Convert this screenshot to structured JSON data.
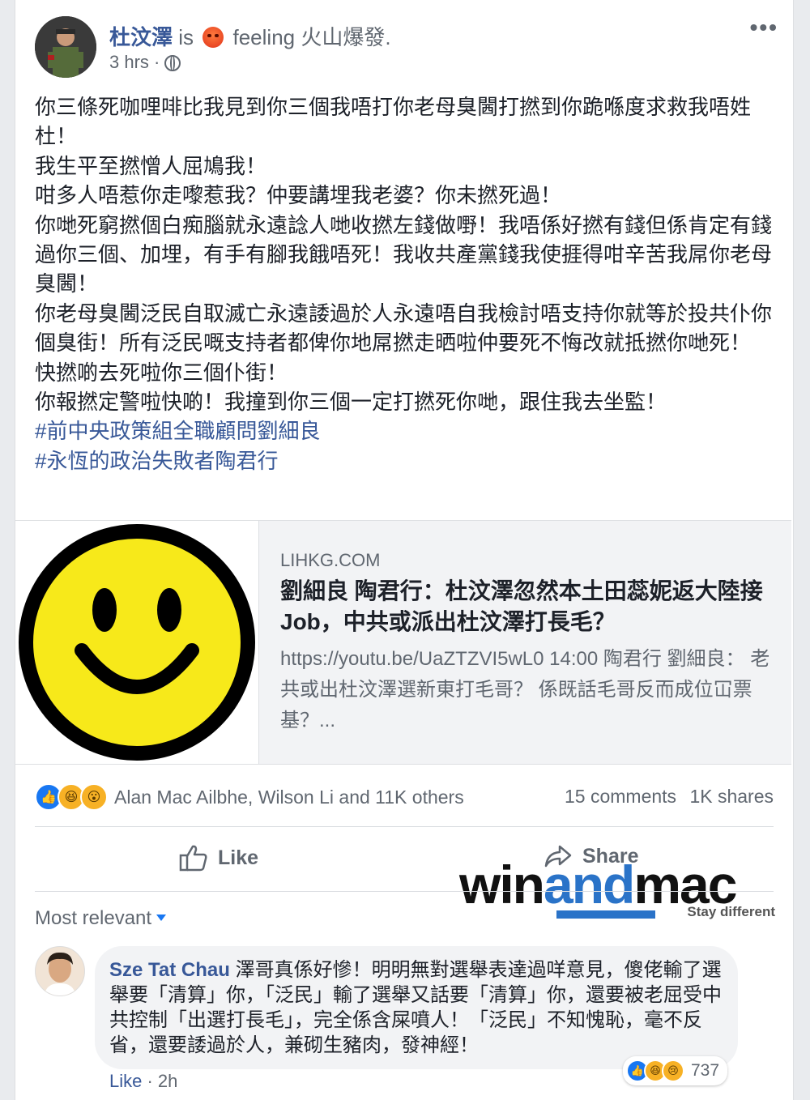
{
  "post": {
    "author": "杜汶澤",
    "feeling_prefix": "is",
    "feeling": "feeling 火山爆發.",
    "time": "3 hrs ·",
    "more_label": "•••",
    "text_lines": [
      "你三條死咖哩啡比我見到你三個我唔打你老母臭閪打撚到你跪喺度求救我唔姓杜！",
      "我生平至撚憎人屈鳩我！",
      "咁多人唔惹你走嚟惹我？仲要講埋我老婆？你未撚死過！",
      "你哋死窮撚個白痴腦就永遠諗人哋收撚左錢做嘢！我唔係好撚有錢但係肯定有錢過你三個、加埋，有手有腳我餓唔死！我收共產黨錢我使捱得咁辛苦我屌你老母臭閪！",
      "你老母臭閪泛民自取滅亡永遠諉過於人永遠唔自我檢討唔支持你就等於投共仆你個臭街！所有泛民嘅支持者都俾你地屌撚走晒啦仲要死不悔改就抵撚你哋死！",
      "快撚啲去死啦你三個仆街！",
      "你報撚定警啦快啲！我撞到你三個一定打撚死你哋，跟住我去坐監！"
    ],
    "hashtags": [
      "#前中央政策組全職顧問劉細良",
      "#永恆的政治失敗者陶君行"
    ]
  },
  "link": {
    "domain": "LIHKG.COM",
    "title": "劉細良 陶君行：杜汶澤忽然本土田蕊妮返大陸接Job，中共或派出杜汶澤打長毛？",
    "description": "https://youtu.be/UaZTZVI5wL0 14:00 陶君行 劉細良： 老共或出杜汶澤選新東打毛哥？ 係既話毛哥反而成位冚票基？..."
  },
  "reactions": {
    "names": "Alan Mac Ailbhe, Wilson Li and 11K others",
    "comments": "15 comments",
    "shares": "1K shares"
  },
  "actions": {
    "like": "Like",
    "share": "Share"
  },
  "watermark": {
    "win": "win",
    "and": "and",
    "mac": "mac",
    "tagline": "Stay different"
  },
  "comments_section": {
    "sort": "Most relevant",
    "comment": {
      "author": "Sze Tat Chau",
      "text": "澤哥真係好慘！明明無對選舉表達過咩意見，傻佬輸了選舉要「清算」你，「泛民」輸了選舉又話要「清算」你，還要被老屈受中共控制「出選打長毛」，完全係含屎噴人！「泛民」不知愧恥，毫不反省，還要諉過於人，兼砌生豬肉，發神經！",
      "reaction_count": "737",
      "like": "Like",
      "time": "· 2h"
    }
  },
  "colors": {
    "link_blue": "#385898",
    "fb_blue": "#1877f2",
    "smiley_yellow": "#f7e91a"
  }
}
